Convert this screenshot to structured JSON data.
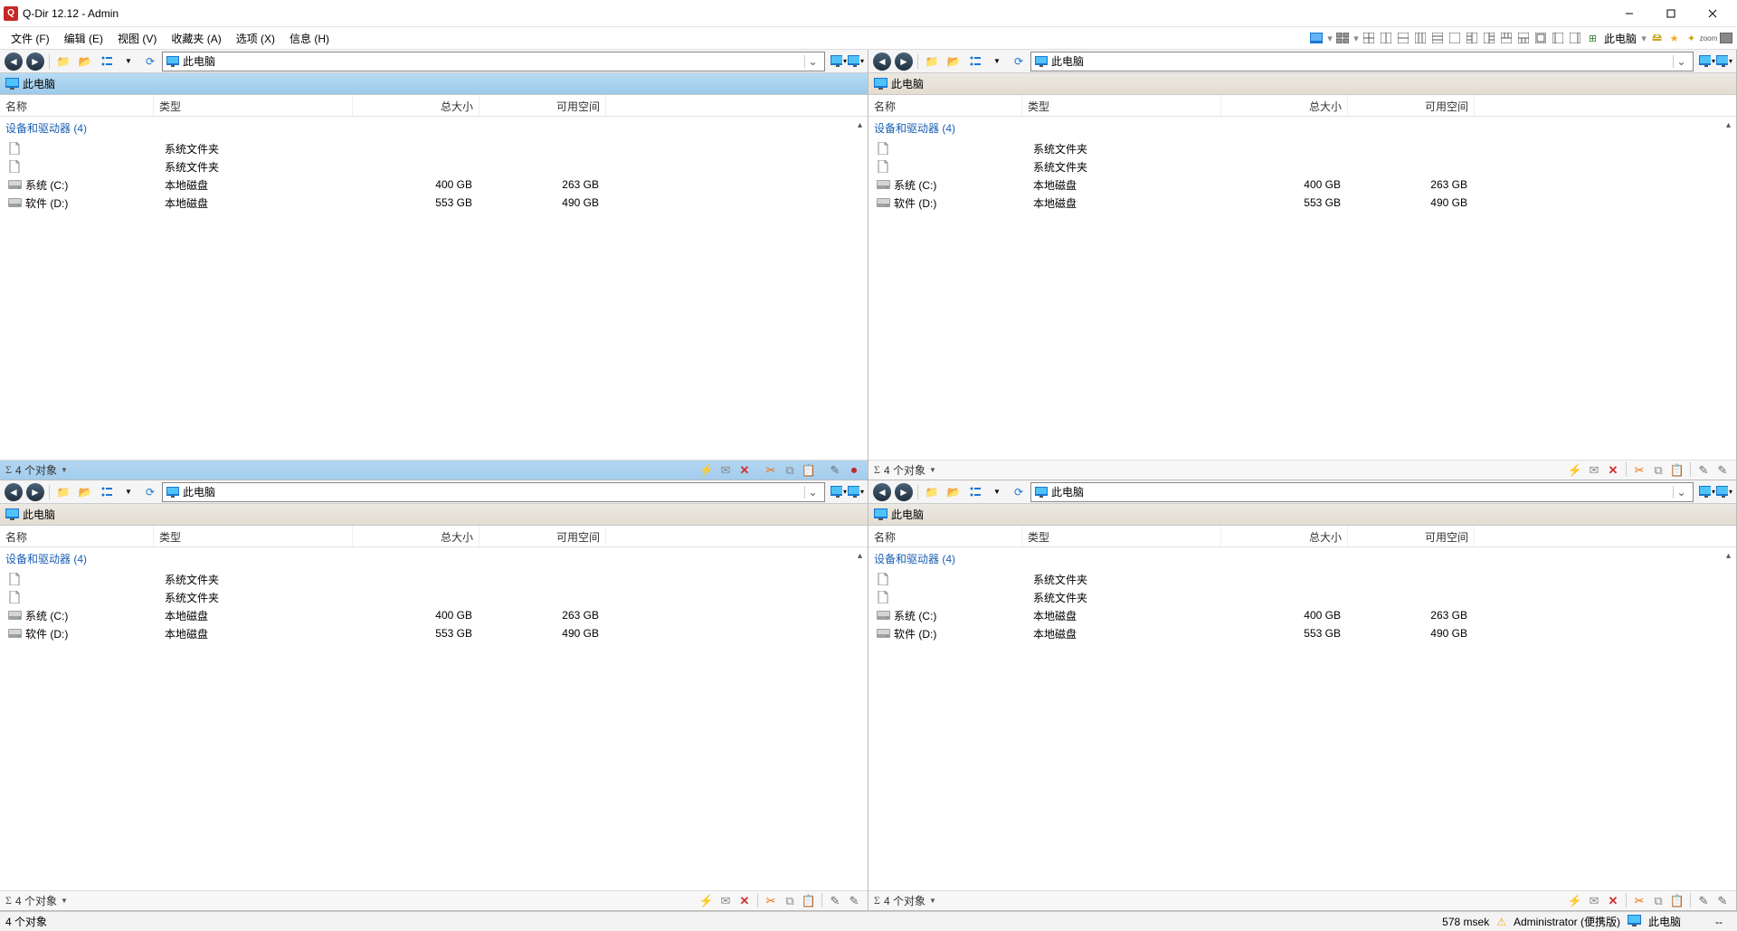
{
  "window": {
    "title": "Q-Dir 12.12 - Admin"
  },
  "menu": {
    "items": [
      "文件 (F)",
      "编辑 (E)",
      "视图 (V)",
      "收藏夹 (A)",
      "选项 (X)",
      "信息 (H)"
    ],
    "right_label": "此电脑"
  },
  "columns": {
    "name": "名称",
    "type": "类型",
    "size": "总大小",
    "free": "可用空间"
  },
  "group": {
    "label": "设备和驱动器 (4)"
  },
  "rows": [
    {
      "icon": "file",
      "name": "",
      "type": "系统文件夹",
      "size": "",
      "free": ""
    },
    {
      "icon": "file",
      "name": "",
      "type": "系统文件夹",
      "size": "",
      "free": ""
    },
    {
      "icon": "drive",
      "name": "系统 (C:)",
      "type": "本地磁盘",
      "size": "400 GB",
      "free": "263 GB"
    },
    {
      "icon": "drive",
      "name": "软件 (D:)",
      "type": "本地磁盘",
      "size": "553 GB",
      "free": "490 GB"
    }
  ],
  "pane": {
    "address": "此电脑",
    "crumb": "此电脑",
    "status": "4 个对象"
  },
  "global_status": {
    "left": "4 个对象",
    "msek": "578 msek",
    "user": "Administrator (便携版)",
    "loc": "此电脑",
    "dash": "--"
  }
}
